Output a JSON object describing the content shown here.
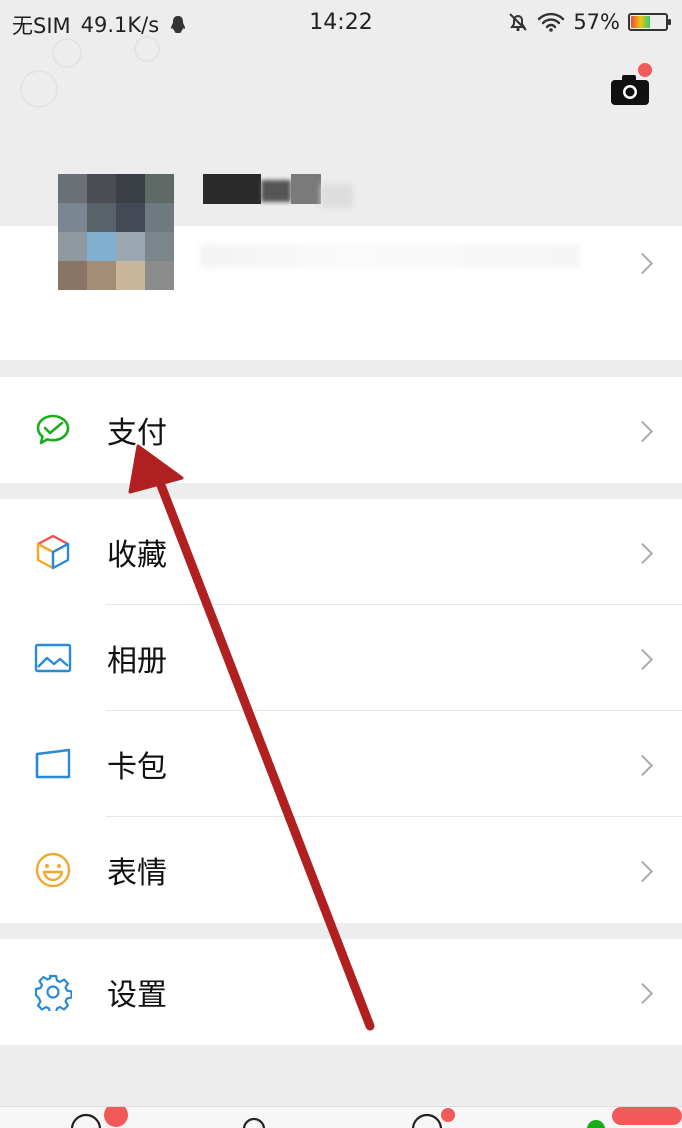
{
  "status_bar": {
    "carrier": "无SIM",
    "speed": "49.1K/s",
    "time": "14:22",
    "battery_percent": "57%",
    "battery_level": 0.57
  },
  "colors": {
    "pay_green": "#1aad19",
    "collect_multi": "#f5a623",
    "album_blue": "#2b8ad7",
    "card_blue": "#2b8ad7",
    "emoji_yellow": "#f0a92e",
    "settings_blue": "#2b8ad7",
    "arrow_red": "#b02020",
    "badge_red": "#f25a5a"
  },
  "menu": {
    "pay": {
      "label": "支付",
      "icon": "wechat-pay-icon"
    },
    "items": [
      {
        "label": "收藏",
        "icon": "favorites-cube-icon"
      },
      {
        "label": "相册",
        "icon": "album-image-icon"
      },
      {
        "label": "卡包",
        "icon": "card-wallet-icon"
      },
      {
        "label": "表情",
        "icon": "smiley-face-icon"
      }
    ],
    "settings": {
      "label": "设置",
      "icon": "gear-icon"
    }
  },
  "header": {
    "camera_icon": "camera-icon"
  }
}
